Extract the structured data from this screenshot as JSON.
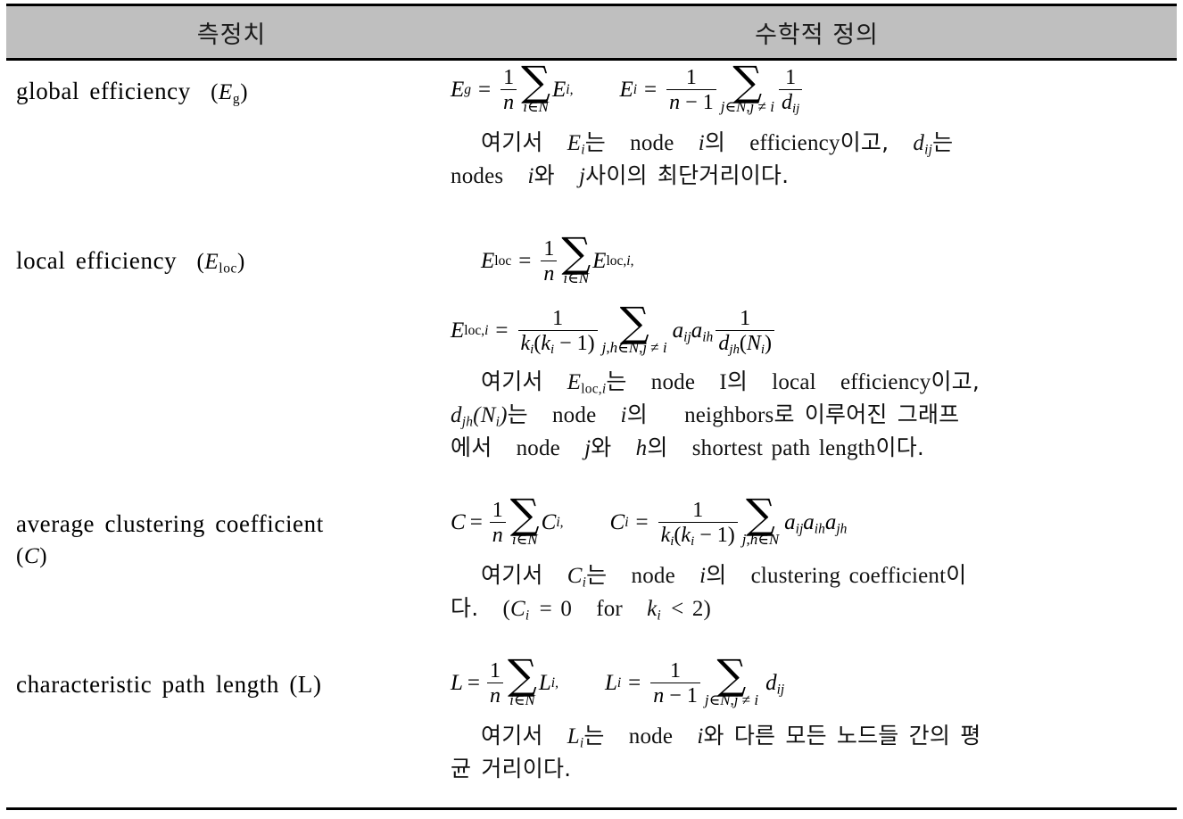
{
  "table": {
    "header": {
      "measure_label": "측정치",
      "definition_label": "수학적 정의"
    },
    "colors": {
      "header_background": "#bfbfbf",
      "rule": "#000000",
      "text": "#000000",
      "page_background": "#ffffff"
    },
    "rows": [
      {
        "id": "global-efficiency",
        "label_text": "global efficiency",
        "label_symbol": "(E_g)",
        "label_plain": "global efficiency (Eg)",
        "formula_plain": "E_g = (1/n) Σ_{i∈N} E_i,   E_i = (1/(n−1)) Σ_{j∈N, j≠i} 1/d_ij",
        "formula": {
          "lhs1": "E",
          "lhs1_sub": "g",
          "eq": "=",
          "frac1_num": "1",
          "frac1_den": "n",
          "sum1_lim": "i∈N",
          "term1": "E",
          "term1_sub": "i,",
          "lhs2": "E",
          "lhs2_sub": "i",
          "frac2_num": "1",
          "frac2_den": "n − 1",
          "sum2_lim": "j∈N, j ≠ i",
          "frac3_num": "1",
          "frac3_den": "d",
          "frac3_den_sub": "ij"
        },
        "note_plain": "여기서 Ei는 node i의 efficiency이고, dij는 nodes i와 j사이의 최단거리이다.",
        "note": {
          "l1_a": "여기서",
          "l1_sym": "E",
          "l1_sym_sub": "i",
          "l1_b": "는",
          "l1_node": "node",
          "l1_i": "i",
          "l1_c": "의",
          "l1_eff": "efficiency",
          "l1_d": "이고,",
          "l1_sym2": "d",
          "l1_sym2_sub": "ij",
          "l1_e": "는",
          "l2_nodes": "nodes",
          "l2_i": "i",
          "l2_a": "와",
          "l2_j": "j",
          "l2_b": "사이의  최단거리이다."
        }
      },
      {
        "id": "local-efficiency",
        "label_text": "local efficiency",
        "label_symbol": "(E_loc)",
        "label_plain": "local efficiency (Eloc)",
        "formula_plain": "E_loc = (1/n) Σ_{i∈N} E_loc,i ;  E_loc,i = (1/(k_i(k_i−1))) Σ_{j,h∈N, j≠i} a_ij a_ih · 1/d_jh(N_i)",
        "formula": {
          "lhs1": "E",
          "lhs1_sub": "loc",
          "eq": "=",
          "frac1_num": "1",
          "frac1_den": "n",
          "sum1_lim": "i∈N",
          "term1": "E",
          "term1_sub": "loc,i,",
          "lhs2": "E",
          "lhs2_sub": "loc,i",
          "frac2_num": "1",
          "frac2_den": "k",
          "frac2_den_sub": "i",
          "frac2_den_rest": "(k",
          "frac2_den_rest_sub": "i",
          "frac2_den_tail": " − 1)",
          "sum2_lim": "j,h∈N, j ≠ i",
          "a_terms": "a",
          "a_sub1": "ij",
          "a_term2": "a",
          "a_sub2": "ih",
          "frac3_num": "1",
          "frac3_den": "d",
          "frac3_den_sub": "jh",
          "frac3_den_tail": "(N",
          "frac3_den_tail_sub": "i",
          "frac3_den_close": ")"
        },
        "note_plain": "여기서 Eloc,i는 node I의 local efficiency이고, djh(Ni)는 node i의 neighbors로 이루어진 그래프에서 node j와 h의 shortest path length이다.",
        "note": {
          "l1_a": "여기서",
          "l1_sym": "E",
          "l1_sym_sub": "loc,i",
          "l1_b": "는",
          "l1_node": "node",
          "l1_I": "I",
          "l1_c": "의",
          "l1_local": "local",
          "l1_eff": "efficiency",
          "l1_d": "이고,",
          "l2_sym": "d",
          "l2_sym_sub": "jh",
          "l2_sym_tail": "(N",
          "l2_sym_tail_sub": "i",
          "l2_sym_close": ")",
          "l2_a": "는",
          "l2_node": "node",
          "l2_i": "i",
          "l2_b": "의",
          "l2_nb": "neighbors",
          "l2_c": "로  이루어진  그래프",
          "l3_a": "에서",
          "l3_node": "node",
          "l3_j": "j",
          "l3_b": "와",
          "l3_h": "h",
          "l3_c": "의",
          "l3_sp": "shortest path length",
          "l3_d": "이다."
        }
      },
      {
        "id": "average-clustering-coefficient",
        "label_text": "average  clustering  coefficient",
        "label_symbol": "(C)",
        "label_plain": "average clustering coefficient (C)",
        "formula_plain": "C = (1/n) Σ_{i∈N} C_i,   C_i = (1/(k_i(k_i−1))) Σ_{j,h∈N} a_ij a_ih a_jh",
        "formula": {
          "lhs1": "C",
          "eq": "=",
          "frac1_num": "1",
          "frac1_den": "n",
          "sum1_lim": "i∈N",
          "term1": "C",
          "term1_sub": "i,",
          "lhs2": "C",
          "lhs2_sub": "i",
          "frac2_num": "1",
          "frac2_den": "k",
          "frac2_den_sub": "i",
          "frac2_den_rest": "(k",
          "frac2_den_rest_sub": "i",
          "frac2_den_tail": " − 1)",
          "sum2_lim": "j,h∈N",
          "a1": "a",
          "a1_sub": "ij",
          "a2": "a",
          "a2_sub": "ih",
          "a3": "a",
          "a3_sub": "jh"
        },
        "note_plain": "여기서 Ci는 node i의 clustering coefficient이다. (Ci = 0 for ki < 2)",
        "note": {
          "l1_a": "여기서",
          "l1_sym": "C",
          "l1_sym_sub": "i",
          "l1_b": "는",
          "l1_node": "node",
          "l1_i": "i",
          "l1_c": "의",
          "l1_cc": "clustering  coefficient",
          "l1_d": "이",
          "l2_a": "다.",
          "l2_open": "(",
          "l2_sym": "C",
          "l2_sym_sub": "i",
          "l2_eq": "= 0",
          "l2_for": "for",
          "l2_k": "k",
          "l2_k_sub": "i",
          "l2_lt": "< 2",
          "l2_close": ")"
        }
      },
      {
        "id": "characteristic-path-length",
        "label_text": "characteristic  path  length  (L)",
        "label_symbol": "(L)",
        "label_plain": "characteristic path length (L)",
        "formula_plain": "L = (1/n) Σ_{i∈N} L_i,   L_i = (1/(n−1)) Σ_{j∈N, j≠i} d_ij",
        "formula": {
          "lhs1": "L",
          "eq": "=",
          "frac1_num": "1",
          "frac1_den": "n",
          "sum1_lim": "i∈N",
          "term1": "L",
          "term1_sub": "i,",
          "lhs2": "L",
          "lhs2_sub": "i",
          "frac2_num": "1",
          "frac2_den": "n − 1",
          "sum2_lim": "j∈N, j ≠ i",
          "term2": "d",
          "term2_sub": "ij"
        },
        "note_plain": "여기서 Li는 node i와 다른 모든 노드들 간의 평균 거리이다.",
        "note": {
          "l1_a": "여기서",
          "l1_sym": "L",
          "l1_sym_sub": "i",
          "l1_b": "는",
          "l1_node": "node",
          "l1_i": "i",
          "l1_c": "와  다른  모든  노드들  간의  평",
          "l2_a": "균  거리이다."
        }
      }
    ]
  }
}
